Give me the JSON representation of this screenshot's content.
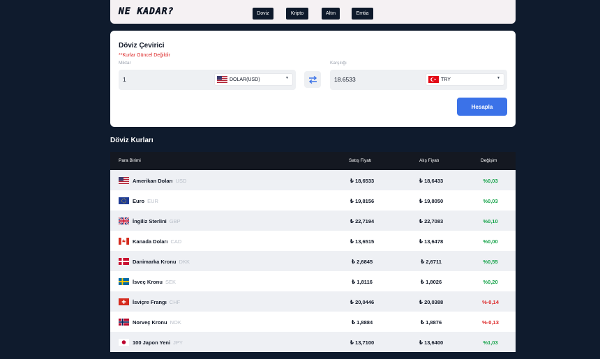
{
  "header": {
    "logo": "NE KADAR?",
    "nav": [
      "Doviz",
      "Kripto",
      "Altın",
      "Emtia"
    ]
  },
  "converter": {
    "title": "Döviz Çevirici",
    "warning": "**Kurlar Güncel Değildir",
    "amount_label": "Miktar",
    "amount_value": "1",
    "from_currency": "DOLAR(USD)",
    "result_label": "Karşılığı",
    "result_value": "18.6533",
    "to_currency": "TRY",
    "calculate_label": "Hesapla"
  },
  "rates": {
    "title": "Döviz Kurları",
    "columns": [
      "Para Birimi",
      "Satış Fiyatı",
      "Alış Fiyatı",
      "Değişim"
    ],
    "rows": [
      {
        "name": "Amerikan Doları",
        "code": "USD",
        "sell": "₺ 18,6533",
        "buy": "₺ 18,6433",
        "change": "%0,03",
        "flag": "us-flag-icon"
      },
      {
        "name": "Euro",
        "code": "EUR",
        "sell": "₺ 19,8156",
        "buy": "₺ 19,8050",
        "change": "%0,03",
        "flag": "eu-flag-icon"
      },
      {
        "name": "İngiliz Sterlini",
        "code": "GBP",
        "sell": "₺ 22,7194",
        "buy": "₺ 22,7083",
        "change": "%0,10",
        "flag": "uk-flag-icon"
      },
      {
        "name": "Kanada Doları",
        "code": "CAD",
        "sell": "₺ 13,6515",
        "buy": "₺ 13,6478",
        "change": "%0,00",
        "flag": "ca-flag-icon"
      },
      {
        "name": "Danimarka Kronu",
        "code": "DKK",
        "sell": "₺ 2,6845",
        "buy": "₺ 2,6711",
        "change": "%0,55",
        "flag": "dk-flag-icon"
      },
      {
        "name": "İsveç Kronu",
        "code": "SEK",
        "sell": "₺ 1,8116",
        "buy": "₺ 1,8026",
        "change": "%0,20",
        "flag": "se-flag-icon"
      },
      {
        "name": "İsviçre Frangı",
        "code": "CHF",
        "sell": "₺ 20,0446",
        "buy": "₺ 20,0388",
        "change": "%-0,14",
        "flag": "ch-flag-icon"
      },
      {
        "name": "Norveç Kronu",
        "code": "NOK",
        "sell": "₺ 1,8884",
        "buy": "₺ 1,8876",
        "change": "%-0,13",
        "flag": "no-flag-icon"
      },
      {
        "name": "100 Japon Yeni",
        "code": "JPY",
        "sell": "₺ 13,7100",
        "buy": "₺ 13,6400",
        "change": "%1,03",
        "flag": "jp-flag-icon"
      }
    ]
  },
  "colors": {
    "background": "#0f1b2d",
    "accent": "#3b72e8",
    "positive": "#16a34a",
    "negative": "#dc2626",
    "warning": "#dc2626"
  }
}
